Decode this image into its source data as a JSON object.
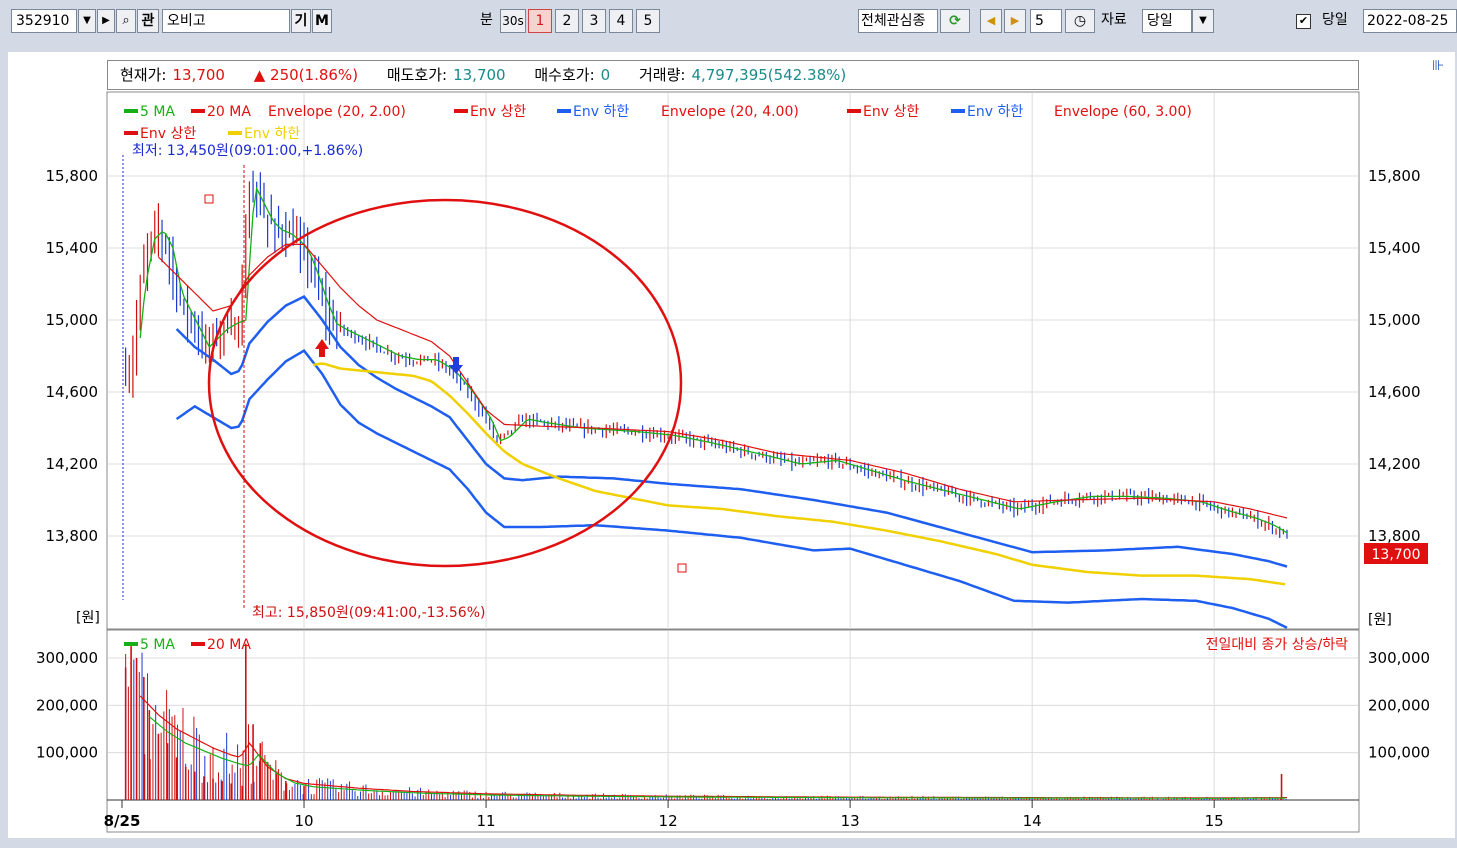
{
  "toolbar": {
    "code": "352910",
    "btn_kwan": "관",
    "name": "오비고",
    "btn_gi": "기",
    "btn_m": "M",
    "unit_label": "분",
    "unit_30s": "30s",
    "intervals": [
      "1",
      "2",
      "3",
      "4",
      "5"
    ],
    "group": "전체관심종",
    "step": "5",
    "data_label": "자료",
    "data_select": "당일",
    "today_check": "✔",
    "today_label": "당일",
    "date": "2022-08-25"
  },
  "info": {
    "price_label": "현재가:",
    "price": "13,700",
    "change": "▲ 250(1.86%)",
    "ask_label": "매도호가:",
    "ask": "13,700",
    "bid_label": "매수호가:",
    "bid": "0",
    "volume_label": "거래량:",
    "volume": "4,797,395(542.38%)"
  },
  "legend": {
    "ma5": "5 MA",
    "ma20": "20 MA",
    "env1": "Envelope (20, 2.00)",
    "env1_up": "Env 상한",
    "env1_dn": "Env 하한",
    "env2": "Envelope (20, 4.00)",
    "env2_up": "Env 상한",
    "env2_dn": "Env 하한",
    "env3": "Envelope (60, 3.00)",
    "env3_up": "Env 상한",
    "env3_dn": "Env 하한"
  },
  "annotations": {
    "low": "최저: 13,450원(09:01:00,+1.86%)",
    "high": "최고: 15,850원(09:41:00,-13.56%)",
    "volume_note": "전일대비 종가 상승/하락",
    "price_unit_left": "[원]",
    "price_unit_right": "[원]",
    "last_price": "13,700"
  },
  "colors": {
    "ma5": "#16b016",
    "ma20": "#e01010",
    "env_upper": "#e01010",
    "env_lower": "#1e5ef0",
    "env3_lower": "#f0d000",
    "circle": "#e01010",
    "up_arrow": "#e01010",
    "down_arrow": "#1e3ee0"
  },
  "chart_data": {
    "type": "line",
    "price_ylim": [
      13450,
      15950
    ],
    "price_ticks": [
      13800,
      14200,
      14600,
      15000,
      15400,
      15800
    ],
    "price_tick_labels": [
      "13,800",
      "14,200",
      "14,600",
      "15,000",
      "15,400",
      "15,800"
    ],
    "volume_ylim": [
      0,
      340000
    ],
    "volume_ticks": [
      100000,
      200000,
      300000
    ],
    "volume_tick_labels": [
      "100,000",
      "200,000",
      "300,000"
    ],
    "x_range": [
      9.0,
      15.55
    ],
    "x_ticks": [
      9.0,
      10,
      11,
      12,
      13,
      14,
      15
    ],
    "x_tick_labels": [
      "8/25",
      "10",
      "11",
      "12",
      "13",
      "14",
      "15"
    ],
    "close": [
      [
        9.05,
        14700
      ],
      [
        9.1,
        15200
      ],
      [
        9.15,
        15450
      ],
      [
        9.2,
        15500
      ],
      [
        9.25,
        15400
      ],
      [
        9.3,
        15150
      ],
      [
        9.35,
        15050
      ],
      [
        9.4,
        14950
      ],
      [
        9.45,
        14850
      ],
      [
        9.5,
        14900
      ],
      [
        9.55,
        14950
      ],
      [
        9.6,
        14980
      ],
      [
        9.65,
        15000
      ],
      [
        9.7,
        15750
      ],
      [
        9.75,
        15650
      ],
      [
        9.8,
        15550
      ],
      [
        9.85,
        15500
      ],
      [
        9.9,
        15480
      ],
      [
        9.95,
        15440
      ],
      [
        10.0,
        15380
      ],
      [
        10.05,
        15250
      ],
      [
        10.1,
        15100
      ],
      [
        10.15,
        14980
      ],
      [
        10.2,
        14950
      ],
      [
        10.3,
        14900
      ],
      [
        10.4,
        14850
      ],
      [
        10.5,
        14800
      ],
      [
        10.6,
        14780
      ],
      [
        10.7,
        14780
      ],
      [
        10.8,
        14720
      ],
      [
        10.9,
        14600
      ],
      [
        11.0,
        14450
      ],
      [
        11.05,
        14330
      ],
      [
        11.1,
        14350
      ],
      [
        11.2,
        14450
      ],
      [
        11.3,
        14430
      ],
      [
        11.5,
        14400
      ],
      [
        11.8,
        14380
      ],
      [
        12.0,
        14360
      ],
      [
        12.2,
        14320
      ],
      [
        12.5,
        14250
      ],
      [
        12.7,
        14200
      ],
      [
        12.9,
        14220
      ],
      [
        13.1,
        14160
      ],
      [
        13.3,
        14100
      ],
      [
        13.5,
        14050
      ],
      [
        13.7,
        14000
      ],
      [
        13.9,
        13950
      ],
      [
        14.1,
        13990
      ],
      [
        14.3,
        14020
      ],
      [
        14.5,
        14020
      ],
      [
        14.7,
        14010
      ],
      [
        14.9,
        13990
      ],
      [
        15.05,
        13940
      ],
      [
        15.2,
        13900
      ],
      [
        15.3,
        13860
      ],
      [
        15.4,
        13800
      ]
    ],
    "ma20": [
      [
        9.2,
        15350
      ],
      [
        9.3,
        15250
      ],
      [
        9.4,
        15150
      ],
      [
        9.5,
        15050
      ],
      [
        9.6,
        15080
      ],
      [
        9.7,
        15250
      ],
      [
        9.8,
        15350
      ],
      [
        9.9,
        15420
      ],
      [
        10.0,
        15420
      ],
      [
        10.1,
        15300
      ],
      [
        10.2,
        15180
      ],
      [
        10.3,
        15080
      ],
      [
        10.4,
        15000
      ],
      [
        10.5,
        14960
      ],
      [
        10.6,
        14920
      ],
      [
        10.7,
        14880
      ],
      [
        10.8,
        14800
      ],
      [
        10.9,
        14650
      ],
      [
        11.0,
        14500
      ],
      [
        11.1,
        14420
      ],
      [
        11.3,
        14410
      ],
      [
        11.6,
        14400
      ],
      [
        12.0,
        14380
      ],
      [
        12.3,
        14330
      ],
      [
        12.6,
        14260
      ],
      [
        13.0,
        14220
      ],
      [
        13.3,
        14150
      ],
      [
        13.6,
        14060
      ],
      [
        13.9,
        13990
      ],
      [
        14.2,
        14000
      ],
      [
        14.6,
        14010
      ],
      [
        15.0,
        13990
      ],
      [
        15.2,
        13950
      ],
      [
        15.4,
        13900
      ]
    ],
    "env_20_2_lower": [
      [
        9.3,
        14950
      ],
      [
        9.4,
        14850
      ],
      [
        9.5,
        14780
      ],
      [
        9.6,
        14700
      ],
      [
        9.65,
        14720
      ],
      [
        9.7,
        14870
      ],
      [
        9.8,
        14990
      ],
      [
        9.9,
        15080
      ],
      [
        10.0,
        15130
      ],
      [
        10.1,
        15000
      ],
      [
        10.2,
        14850
      ],
      [
        10.3,
        14750
      ],
      [
        10.4,
        14680
      ],
      [
        10.5,
        14620
      ],
      [
        10.6,
        14570
      ],
      [
        10.7,
        14520
      ],
      [
        10.8,
        14460
      ],
      [
        10.9,
        14330
      ],
      [
        11.0,
        14200
      ],
      [
        11.1,
        14120
      ],
      [
        11.2,
        14110
      ],
      [
        11.4,
        14130
      ],
      [
        11.7,
        14120
      ],
      [
        12.0,
        14090
      ],
      [
        12.4,
        14060
      ],
      [
        12.8,
        14000
      ],
      [
        13.2,
        13930
      ],
      [
        13.6,
        13820
      ],
      [
        14.0,
        13710
      ],
      [
        14.4,
        13720
      ],
      [
        14.8,
        13740
      ],
      [
        15.1,
        13700
      ],
      [
        15.3,
        13660
      ],
      [
        15.4,
        13630
      ]
    ],
    "env_20_4_lower": [
      [
        9.3,
        14450
      ],
      [
        9.4,
        14520
      ],
      [
        9.5,
        14460
      ],
      [
        9.6,
        14400
      ],
      [
        9.65,
        14410
      ],
      [
        9.7,
        14560
      ],
      [
        9.8,
        14670
      ],
      [
        9.9,
        14770
      ],
      [
        10.0,
        14830
      ],
      [
        10.1,
        14700
      ],
      [
        10.2,
        14530
      ],
      [
        10.3,
        14430
      ],
      [
        10.4,
        14370
      ],
      [
        10.5,
        14320
      ],
      [
        10.6,
        14270
      ],
      [
        10.7,
        14220
      ],
      [
        10.8,
        14170
      ],
      [
        10.9,
        14060
      ],
      [
        11.0,
        13930
      ],
      [
        11.1,
        13850
      ],
      [
        11.3,
        13850
      ],
      [
        11.6,
        13860
      ],
      [
        12.0,
        13830
      ],
      [
        12.4,
        13790
      ],
      [
        12.8,
        13720
      ],
      [
        13.0,
        13730
      ],
      [
        13.3,
        13640
      ],
      [
        13.6,
        13550
      ],
      [
        13.9,
        13440
      ],
      [
        14.2,
        13430
      ],
      [
        14.6,
        13450
      ],
      [
        14.9,
        13440
      ],
      [
        15.1,
        13400
      ],
      [
        15.3,
        13340
      ],
      [
        15.4,
        13290
      ]
    ],
    "env_60_3_lower": [
      [
        10.05,
        14750
      ],
      [
        10.1,
        14760
      ],
      [
        10.2,
        14730
      ],
      [
        10.3,
        14720
      ],
      [
        10.4,
        14710
      ],
      [
        10.5,
        14700
      ],
      [
        10.6,
        14690
      ],
      [
        10.7,
        14660
      ],
      [
        10.8,
        14580
      ],
      [
        10.9,
        14480
      ],
      [
        11.0,
        14370
      ],
      [
        11.1,
        14270
      ],
      [
        11.2,
        14200
      ],
      [
        11.4,
        14120
      ],
      [
        11.6,
        14050
      ],
      [
        11.8,
        14010
      ],
      [
        12.0,
        13970
      ],
      [
        12.3,
        13950
      ],
      [
        12.6,
        13910
      ],
      [
        12.9,
        13880
      ],
      [
        13.2,
        13830
      ],
      [
        13.5,
        13770
      ],
      [
        13.8,
        13700
      ],
      [
        14.0,
        13640
      ],
      [
        14.3,
        13600
      ],
      [
        14.6,
        13580
      ],
      [
        14.9,
        13580
      ],
      [
        15.2,
        13560
      ],
      [
        15.4,
        13530
      ]
    ],
    "volume_ma20": [
      [
        9.1,
        220000
      ],
      [
        9.2,
        180000
      ],
      [
        9.3,
        150000
      ],
      [
        9.35,
        140000
      ],
      [
        9.4,
        130000
      ],
      [
        9.5,
        110000
      ],
      [
        9.6,
        95000
      ],
      [
        9.65,
        90000
      ],
      [
        9.7,
        120000
      ],
      [
        9.8,
        70000
      ],
      [
        9.9,
        45000
      ],
      [
        10.0,
        35000
      ],
      [
        10.3,
        25000
      ],
      [
        10.6,
        18000
      ],
      [
        11.0,
        13000
      ],
      [
        11.5,
        10000
      ],
      [
        12.0,
        8000
      ],
      [
        13.0,
        6000
      ],
      [
        14.0,
        5000
      ],
      [
        15.0,
        4500
      ],
      [
        15.4,
        5000
      ]
    ],
    "volume_spikes": [
      [
        9.02,
        280000
      ],
      [
        9.05,
        325000
      ],
      [
        9.08,
        300000
      ],
      [
        9.12,
        260000
      ],
      [
        9.15,
        190000
      ],
      [
        9.2,
        140000
      ],
      [
        9.25,
        120000
      ],
      [
        9.3,
        90000
      ],
      [
        9.35,
        70000
      ],
      [
        9.4,
        60000
      ],
      [
        9.45,
        50000
      ],
      [
        9.5,
        45000
      ],
      [
        9.55,
        40000
      ],
      [
        9.6,
        35000
      ],
      [
        9.66,
        30000
      ],
      [
        9.68,
        330000
      ],
      [
        9.72,
        160000
      ],
      [
        9.76,
        120000
      ],
      [
        9.8,
        80000
      ],
      [
        9.85,
        60000
      ],
      [
        9.9,
        40000
      ],
      [
        10.0,
        30000
      ],
      [
        15.37,
        55000
      ]
    ]
  }
}
